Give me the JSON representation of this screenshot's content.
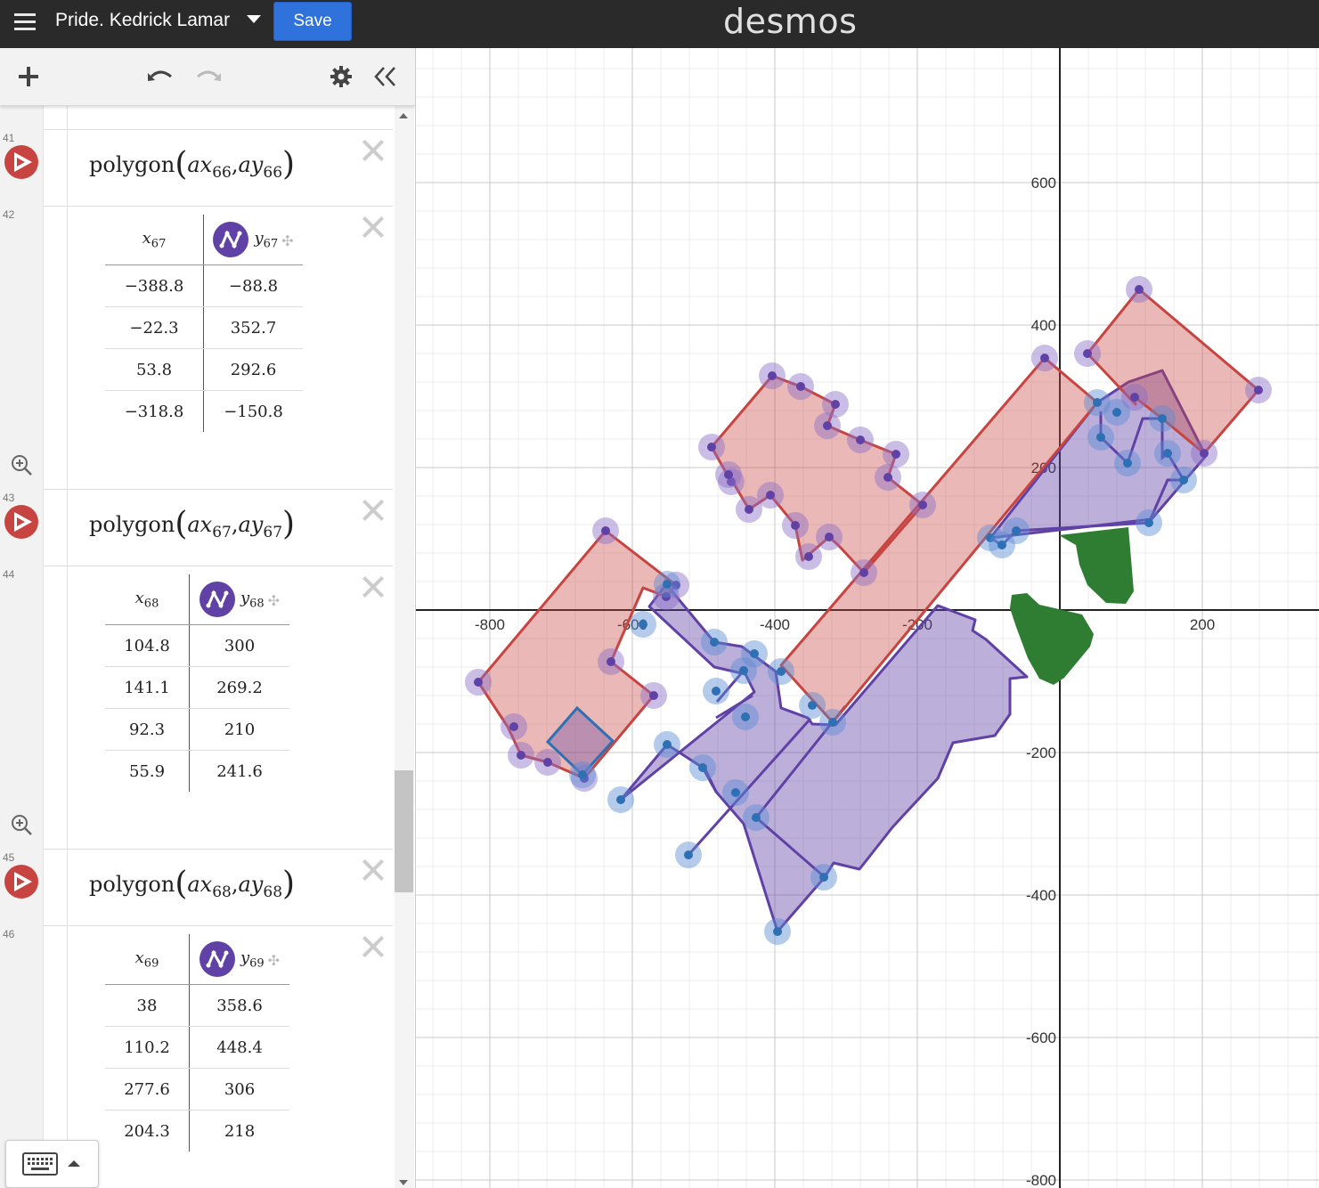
{
  "app": {
    "title": "Pride. Kedrick Lamar",
    "save_label": "Save",
    "logo": "desmos"
  },
  "toolbar": {
    "add_icon": "plus-icon",
    "undo_icon": "undo-icon",
    "redo_icon": "redo-icon",
    "settings_icon": "gear-icon",
    "collapse_icon": "double-chevron-left-icon"
  },
  "expressions": [
    {
      "number": "41",
      "type": "polygon",
      "func": "polygon",
      "a": "ax",
      "b": "ay",
      "sub": "66"
    },
    {
      "number": "42",
      "type": "table",
      "x_name": "x",
      "x_sub": "67",
      "y_name": "y",
      "y_sub": "67",
      "rows": [
        [
          "−388.8",
          "−88.8"
        ],
        [
          "−22.3",
          "352.7"
        ],
        [
          "53.8",
          "292.6"
        ],
        [
          "−318.8",
          "−150.8"
        ]
      ]
    },
    {
      "number": "43",
      "type": "polygon",
      "func": "polygon",
      "a": "ax",
      "b": "ay",
      "sub": "67"
    },
    {
      "number": "44",
      "type": "table",
      "x_name": "x",
      "x_sub": "68",
      "y_name": "y",
      "y_sub": "68",
      "rows": [
        [
          "104.8",
          "300"
        ],
        [
          "141.1",
          "269.2"
        ],
        [
          "92.3",
          "210"
        ],
        [
          "55.9",
          "241.6"
        ]
      ]
    },
    {
      "number": "45",
      "type": "polygon",
      "func": "polygon",
      "a": "ax",
      "b": "ay",
      "sub": "68"
    },
    {
      "number": "46",
      "type": "table",
      "x_name": "x",
      "x_sub": "69",
      "y_name": "y",
      "y_sub": "69",
      "rows": [
        [
          "38",
          "358.6"
        ],
        [
          "110.2",
          "448.4"
        ],
        [
          "277.6",
          "306"
        ],
        [
          "204.3",
          "218"
        ]
      ]
    }
  ],
  "graph": {
    "x_ticks": [
      "-800",
      "-600",
      "-400",
      "-200",
      "200"
    ],
    "y_ticks": [
      "600",
      "400",
      "200",
      "-200",
      "-400",
      "-600",
      "-800"
    ],
    "colors": {
      "red": "#c74440",
      "purple": "#6042a6",
      "blue": "#2d70b3",
      "green": "#2e7d32"
    }
  }
}
